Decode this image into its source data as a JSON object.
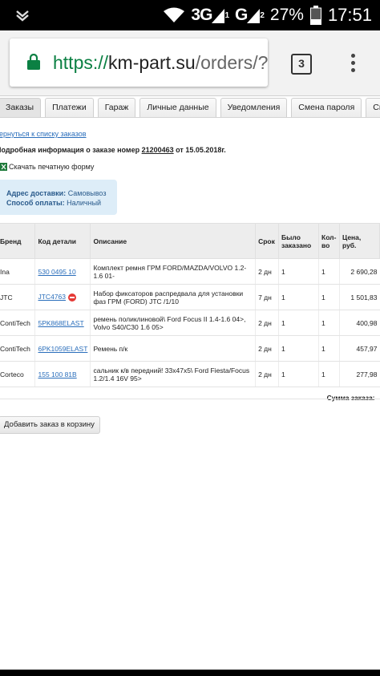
{
  "status_bar": {
    "network": "3G",
    "carrier_signal": "G",
    "sim1": "1",
    "sim2": "2",
    "battery": "27%",
    "time": "17:51"
  },
  "browser": {
    "url_scheme": "https://",
    "url_host": "km-part.su",
    "url_path": "/orders/?",
    "tab_count": "3"
  },
  "tabs": [
    "Заказы",
    "Платежи",
    "Гараж",
    "Личные данные",
    "Уведомления",
    "Смена пароля",
    "Смена офиса"
  ],
  "order": {
    "back_link": "Вернуться к списку заказов",
    "info_prefix": "Подробная информация о заказе номер ",
    "number": "21200463",
    "info_suffix": " от 15.05.2018г.",
    "print_label": "Скачать печатную форму",
    "delivery_label": "Адрес доставки:",
    "delivery_value": "Самовывоз",
    "payment_label": "Способ оплаты:",
    "payment_value": "Наличный"
  },
  "table": {
    "headers": {
      "brand": "Бренд",
      "code": "Код детали",
      "description": "Описание",
      "term": "Срок",
      "ordered": "Было заказано",
      "qty": "Кол-во",
      "price": "Цена, руб."
    },
    "rows": [
      {
        "brand": "Ina",
        "code": "530 0495 10",
        "description": "Комплект ремня ГРМ FORD/MAZDA/VOLVO 1.2-1.6 01-",
        "term": "2 дн",
        "ordered": "1",
        "qty": "1",
        "price": "2 690,28"
      },
      {
        "brand": "JTC",
        "code": "JTC4763",
        "description": "Набор фиксаторов распредвала для установки фаз ГРМ (FORD) JTC /1/10",
        "term": "7 дн",
        "ordered": "1",
        "qty": "1",
        "price": "1 501,83"
      },
      {
        "brand": "ContiTech",
        "code": "5PK868ELAST",
        "description": "ремень поликлиновой\\ Ford Focus II 1.4-1.6 04>, Volvo S40/C30 1.6 05>",
        "term": "2 дн",
        "ordered": "1",
        "qty": "1",
        "price": "400,98"
      },
      {
        "brand": "ContiTech",
        "code": "6PK1059ELAST",
        "description": "Ремень п/к",
        "term": "2 дн",
        "ordered": "1",
        "qty": "1",
        "price": "457,97"
      },
      {
        "brand": "Corteco",
        "code": "155 100 81B",
        "description": "сальник к/в передний! 33x47x5\\ Ford Fiesta/Focus 1.2/1.4 16V 95>",
        "term": "2 дн",
        "ordered": "1",
        "qty": "1",
        "price": "277,98"
      }
    ],
    "sum_label": "Сумма заказа:"
  },
  "add_to_cart_label": "Добавить заказ в корзину",
  "colors": {
    "link": "#2a6ebb",
    "secure_green": "#0b8043",
    "info_box_bg": "#ddedf8",
    "warning_red": "#e53935"
  },
  "icons": [
    "chevron-down-icon",
    "wifi-icon",
    "signal-icon",
    "battery-icon",
    "lock-icon",
    "overflow-menu-icon",
    "excel-file-icon",
    "warning-icon"
  ]
}
